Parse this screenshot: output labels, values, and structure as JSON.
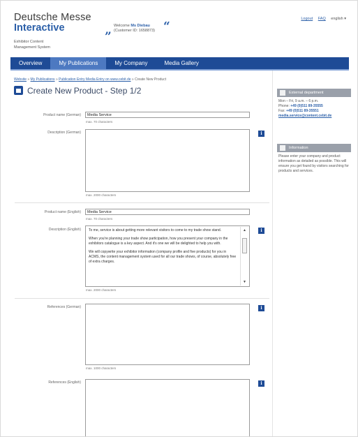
{
  "header": {
    "logo_line1": "Deutsche Messe",
    "logo_line2": "Interactive",
    "system_name": "Exhibitor Content Management System",
    "welcome_prefix": "Welcome",
    "welcome_name": "Ms Diebau",
    "customer_id": "(Customer ID: 1658873)",
    "links": [
      "Logout",
      "FAQ"
    ],
    "language": "english"
  },
  "nav": {
    "tabs": [
      {
        "label": "Overview",
        "active": false
      },
      {
        "label": "My Publications",
        "active": true
      },
      {
        "label": "My Company",
        "active": false
      },
      {
        "label": "Media Gallery",
        "active": false
      }
    ]
  },
  "breadcrumb": {
    "items": [
      "Website",
      "My Publications",
      "Publication Entry Media Entry on www.cebit.de"
    ],
    "current": "Create New Product"
  },
  "page_title": "Create New Product - Step 1/2",
  "form": {
    "name_de": {
      "label": "Product name (German)",
      "value": "Media Service",
      "hint": "max. 70 characters"
    },
    "desc_de": {
      "label": "Description (German)",
      "value": "",
      "hint": "max. 2000 characters"
    },
    "name_en": {
      "label": "Product name (English)",
      "value": "Media Service",
      "hint": "max. 70 characters"
    },
    "desc_en": {
      "label": "Description (English)",
      "paragraphs": [
        "To me, service is about getting more relevant visitors to come to my trade show stand.",
        "When you're planning your trade show participation, how you present your company in the exhibitors catalogue is a key aspect. And it's one we will be delighted to help you with.",
        "We will copywrite your exhibitor information (company profile and five products) for you in ACMS, the content management system used for all our trade shows, of course, absolutely free of extra charges."
      ],
      "hint": "max. 2000 characters"
    },
    "ref_de": {
      "label": "References (German)",
      "value": "",
      "hint": "max. 1000 characters"
    },
    "ref_en": {
      "label": "References (English)",
      "value": ""
    }
  },
  "sidebar": {
    "contact": {
      "title": "External department",
      "hours": "Mon – Fri, 9 a.m. – 6 p.m.",
      "phone_label": "Phone:",
      "phone": "+49 (0)511 89-35555",
      "fax_label": "Fax:",
      "fax": "+49 (0)511 89-35551",
      "email": "media.service@content.cebit.de"
    },
    "info": {
      "title": "Information",
      "text": "Please enter your company and product information as detailed as possible. This will ensure you get found by visitors searching for products and services."
    }
  },
  "colors": {
    "brand_blue": "#1e4b96",
    "active_tab": "#4d79c1",
    "sidebar_head": "#9aa0aa"
  }
}
